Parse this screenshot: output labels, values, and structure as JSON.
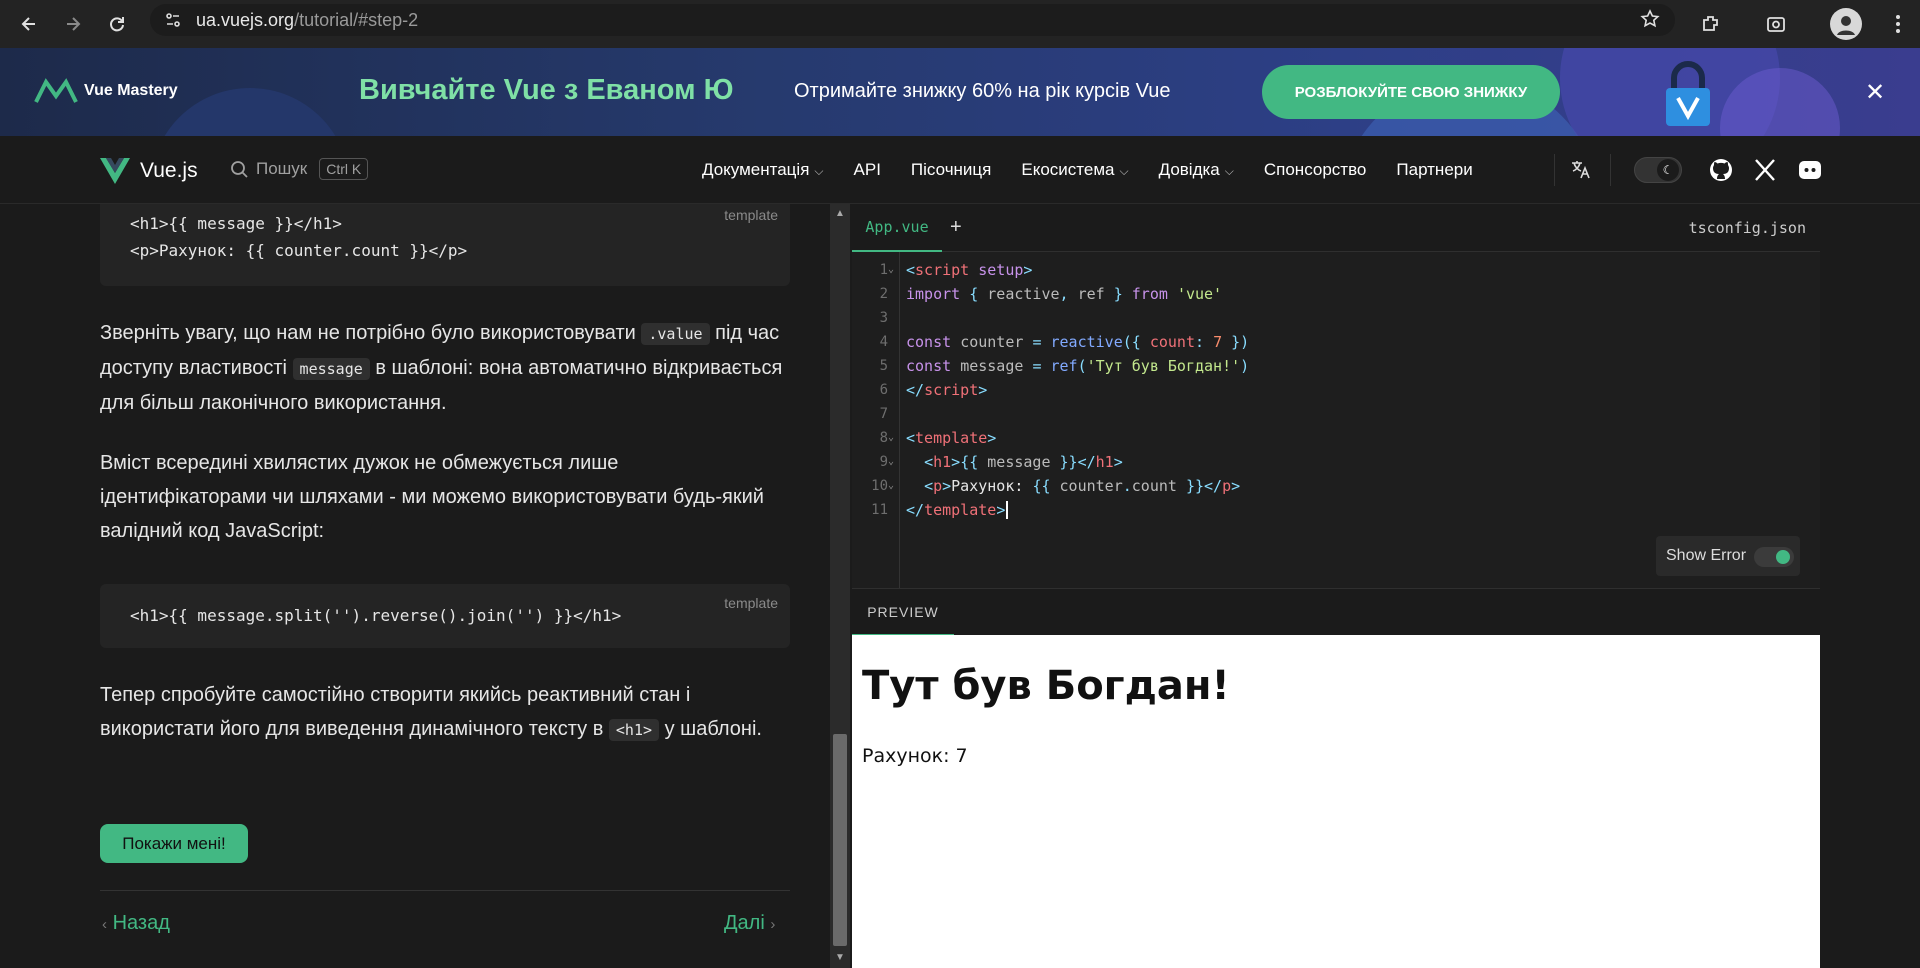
{
  "browser": {
    "url_host": "ua.vuejs.org",
    "url_path": "/tutorial/#step-2"
  },
  "banner": {
    "brand": "Vue Mastery",
    "headline": "Вивчайте Vue з Еваном Ю",
    "sub": "Отримайте знижку 60% на рік курсів Vue",
    "cta": "РОЗБЛОКУЙТЕ СВОЮ ЗНИЖКУ",
    "close": "✕"
  },
  "nav": {
    "logo": "Vue.js",
    "search": "Пошук",
    "shortcut": "Ctrl K",
    "links": [
      "Документація",
      "API",
      "Пісочниця",
      "Екосистема",
      "Довідка",
      "Спонсорство",
      "Партнери"
    ]
  },
  "tutorial": {
    "code1_lang": "template",
    "code1_line1": "<h1>{{ message }}</h1>",
    "code1_line2": "<p>Рахунок: {{ counter.count }}</p>",
    "p1_a": "Зверніть увагу, що нам не потрібно було використовувати",
    "p1_code1": ".value",
    "p1_b": "під час доступу властивості",
    "p1_code2": "message",
    "p1_c": "в шаблоні: вона автоматично відкривається для більш лаконічного використання.",
    "p2": "Вміст всередині хвилястих дужок не обмежується лише ідентифікаторами чи шляхами - ми можемо використовувати будь-який валідний код JavaScript:",
    "code2_lang": "template",
    "code2_line": "<h1>{{ message.split('').reverse().join('') }}</h1>",
    "p3_a": "Тепер спробуйте самостійно створити якийсь реактивний стан і використати його для виведення динамічного тексту в",
    "p3_code": "<h1>",
    "p3_b": "у шаблоні.",
    "show_button": "Покажи мені!",
    "prev": "Назад",
    "next": "Далі"
  },
  "editor": {
    "tab_active": "App.vue",
    "tab_add": "+",
    "tab_config": "tsconfig.json",
    "line_numbers": [
      "1",
      "2",
      "3",
      "4",
      "5",
      "6",
      "7",
      "8",
      "9",
      "10",
      "11"
    ],
    "show_error_label": "Show Error",
    "show_error_on": true
  },
  "preview": {
    "tab": "PREVIEW",
    "heading": "Тут був Богдан!",
    "counter_text": "Рахунок: 7"
  },
  "colors": {
    "accent": "#42b883",
    "background": "#1b1b1b",
    "code_bg": "#242424"
  }
}
